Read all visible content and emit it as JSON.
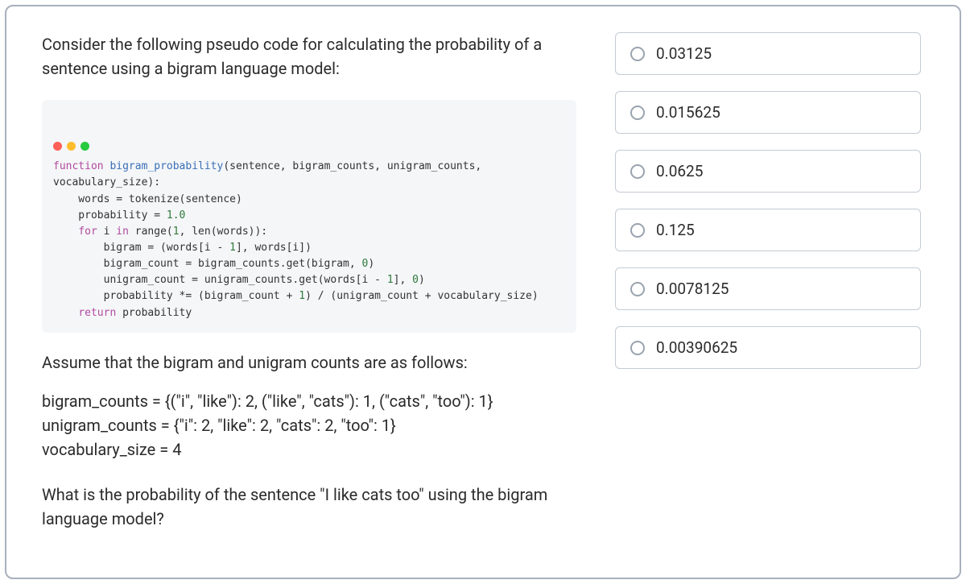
{
  "question": {
    "intro": "Consider the following pseudo code for calculating the probability of a sentence using a bigram language model:",
    "assume": "Assume that the bigram and unigram counts are as follows:",
    "bigram_line": "bigram_counts = {(\"i\", \"like\"): 2, (\"like\", \"cats\"): 1, (\"cats\", \"too\"): 1}",
    "unigram_line": "unigram_counts = {\"i\": 2, \"like\": 2, \"cats\": 2, \"too\": 1}",
    "vocab_line": "vocabulary_size = 4",
    "final": "What is the probability of the sentence \"I like cats too\" using the bigram language model?"
  },
  "options": [
    {
      "label": "0.03125"
    },
    {
      "label": "0.015625"
    },
    {
      "label": "0.0625"
    },
    {
      "label": "0.125"
    },
    {
      "label": "0.0078125"
    },
    {
      "label": "0.00390625"
    }
  ]
}
